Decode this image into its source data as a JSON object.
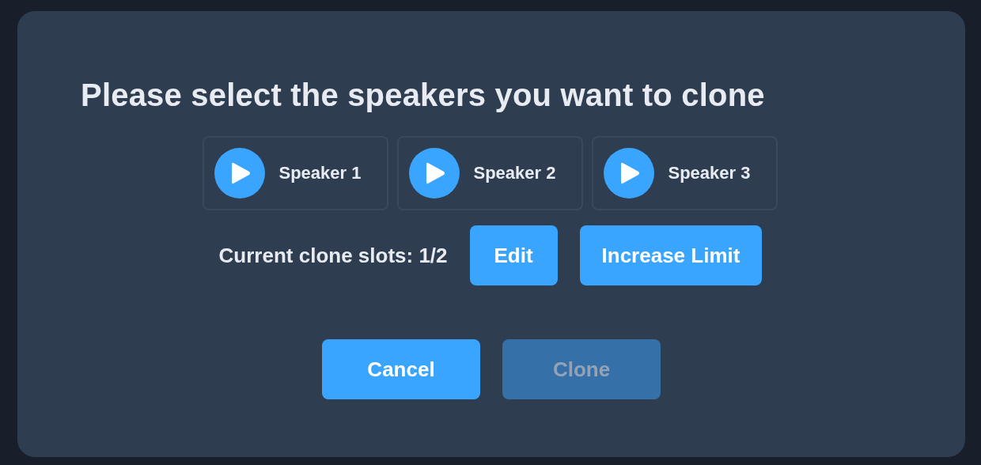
{
  "dialog": {
    "title": "Please select the speakers you want to clone"
  },
  "speakers": [
    {
      "label": "Speaker 1"
    },
    {
      "label": "Speaker 2"
    },
    {
      "label": "Speaker 3"
    }
  ],
  "slots": {
    "text": "Current clone slots: 1/2"
  },
  "slot_buttons": [
    {
      "label": "Edit"
    },
    {
      "label": "Increase Limit"
    }
  ],
  "actions": [
    {
      "label": "Cancel",
      "disabled": false
    },
    {
      "label": "Clone",
      "disabled": true
    }
  ]
}
